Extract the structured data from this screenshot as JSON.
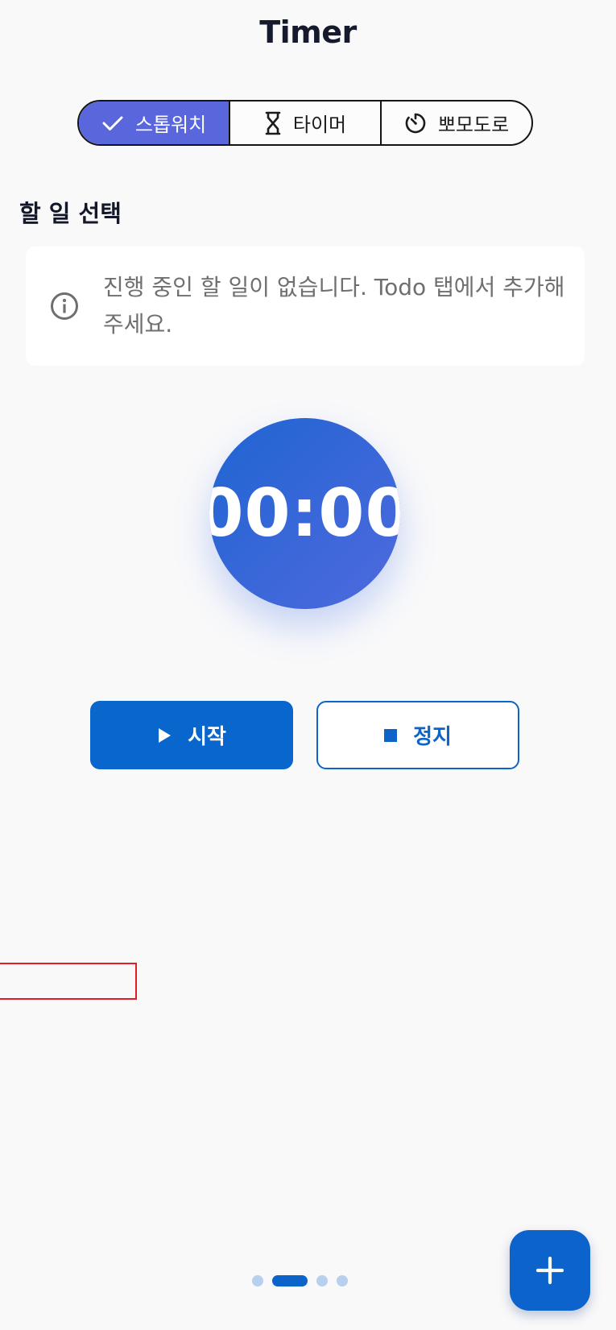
{
  "header": {
    "title": "Timer"
  },
  "mode_tabs": [
    {
      "label": "스톱워치",
      "icon": "check-icon",
      "selected": true
    },
    {
      "label": "타이머",
      "icon": "hourglass-icon",
      "selected": false
    },
    {
      "label": "뽀모도로",
      "icon": "timer-dial-icon",
      "selected": false
    }
  ],
  "task_section": {
    "title": "할 일 선택",
    "empty_message": "진행 중인 할 일이 없습니다. Todo 탭에서 추가해주세요.",
    "icon": "info-icon"
  },
  "clock": {
    "time": "00:00"
  },
  "controls": {
    "start_label": "시작",
    "start_icon": "play-icon",
    "stop_label": "정지",
    "stop_icon": "stop-icon"
  },
  "page_indicator": {
    "count": 4,
    "active_index": 1
  },
  "fab": {
    "icon": "plus-icon"
  },
  "colors": {
    "accent": "#0c63cc",
    "segment_selected": "#5a67dc",
    "clock_gradient_start": "#1e65d2",
    "clock_gradient_end": "#4f6ade",
    "highlight_box": "#e31e24"
  }
}
